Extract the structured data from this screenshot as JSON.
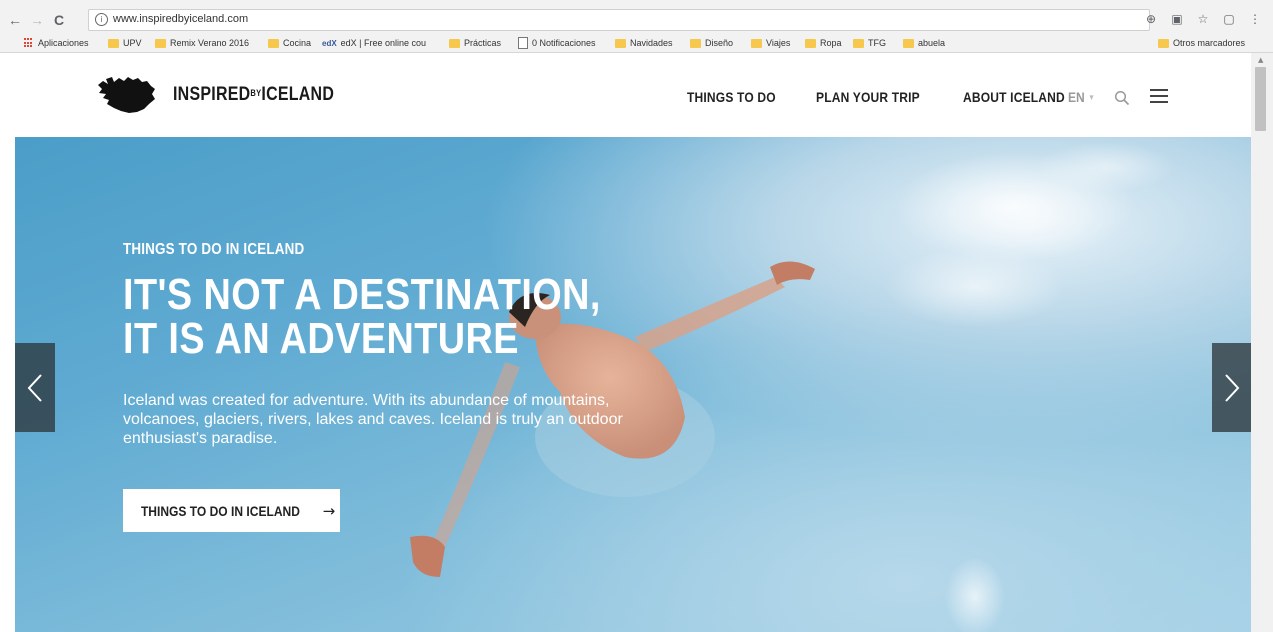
{
  "browser": {
    "url": "www.inspiredbyiceland.com",
    "nav": {
      "back": "←",
      "forward": "→",
      "reload": "C"
    },
    "bookmarks": [
      {
        "label": "Aplicaciones",
        "icon": "apps-grid-icon"
      },
      {
        "label": "UPV",
        "icon": "folder-icon"
      },
      {
        "label": "Remix Verano 2016",
        "icon": "folder-icon"
      },
      {
        "label": "Cocina",
        "icon": "folder-icon"
      },
      {
        "label": "edX | Free online cou",
        "icon": "edx-icon"
      },
      {
        "label": "Prácticas",
        "icon": "folder-icon"
      },
      {
        "label": "0 Notificaciones",
        "icon": "page-icon"
      },
      {
        "label": "Navidades",
        "icon": "folder-icon"
      },
      {
        "label": "Diseño",
        "icon": "folder-icon"
      },
      {
        "label": "Viajes",
        "icon": "folder-icon"
      },
      {
        "label": "Ropa",
        "icon": "folder-icon"
      },
      {
        "label": "TFG",
        "icon": "folder-icon"
      },
      {
        "label": "abuela",
        "icon": "folder-icon"
      }
    ],
    "other_bookmarks": "Otros marcadores"
  },
  "site": {
    "brand": {
      "pre": "INSPIRED",
      "by": "BY",
      "post": "ICELAND"
    },
    "nav": [
      "THINGS TO DO",
      "PLAN YOUR TRIP",
      "ABOUT ICELAND"
    ],
    "language": "EN"
  },
  "hero": {
    "eyebrow": "THINGS TO DO IN ICELAND",
    "title": "IT'S NOT A DESTINATION, IT IS AN ADVENTURE",
    "text": "Iceland was created for adventure. With its abundance of mountains, volcanoes, glaciers, rivers, lakes and caves. Iceland is truly an outdoor enthusiast's paradise.",
    "cta": "THINGS TO DO IN ICELAND",
    "cta_arrow": "→"
  },
  "colors": {
    "hero_water": "#5faad2",
    "arrow_bg": "#2d373c",
    "folder": "#f6c94e"
  }
}
